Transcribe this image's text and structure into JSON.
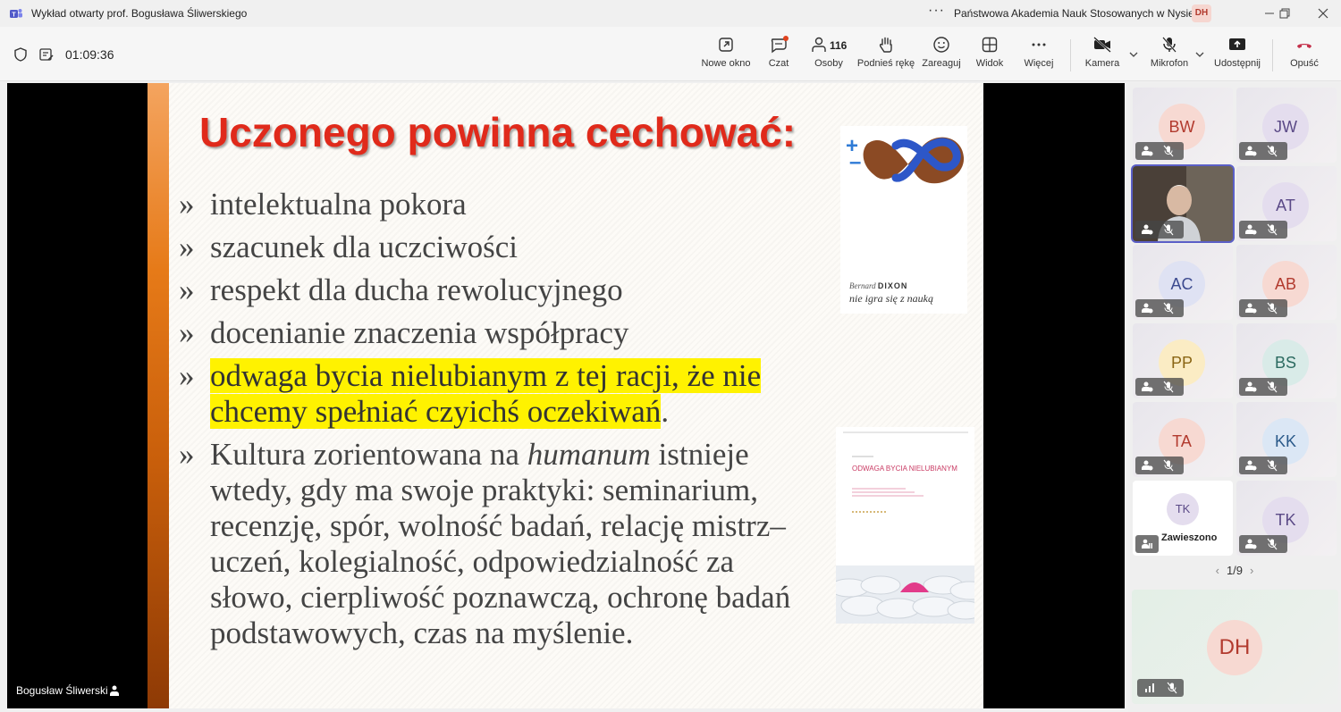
{
  "window": {
    "title": "Wykład otwarty prof. Bogusława Śliwerskiego",
    "more": "···",
    "org": "Państwowa Akademia Nauk Stosowanych w Nysie",
    "org_initials": "DH"
  },
  "toolbar": {
    "timer": "01:09:36",
    "buttons": {
      "new_window": "Nowe okno",
      "chat": "Czat",
      "people": "Osoby",
      "people_count": "116",
      "raise_hand": "Podnieś rękę",
      "react": "Zareaguj",
      "view": "Widok",
      "more": "Więcej",
      "camera": "Kamera",
      "mic": "Mikrofon",
      "share": "Udostępnij",
      "leave": "Opuść"
    },
    "leave_color": "#c4314b"
  },
  "stage": {
    "speaker_name": "Bogusław Śliwerski",
    "slide": {
      "title": "Uczonego powinna cechować:",
      "bullet_mark": "»",
      "bullets": [
        "intelektualna pokora",
        "szacunek dla uczciwości",
        "respekt dla ducha rewolucyjnego",
        "docenianie znaczenia współpracy"
      ],
      "highlight_line1": "odwaga bycia nielubianym z tej racji, że nie",
      "highlight_line2": "chcemy spełniać czyichś oczekiwań",
      "highlight_end": ".",
      "last_pre": "Kultura zorientowana na ",
      "last_italic": "humanum",
      "last_post": " istnieje wtedy, gdy ma swoje praktyki: seminarium, recenzję, spór, wolność badań, relację mistrz–uczeń, kolegialność, odpowiedzialność za słowo, cierpliwość poznawczą, ochronę badań podstawowych, czas na myślenie.",
      "book1_author_first": "Bernard",
      "book1_author_last": "DIXON",
      "book1_title": "nie igra się z nauką",
      "book2_title": "ODWAGA BYCIA NIELUBIANYM"
    }
  },
  "participants": [
    {
      "initials": "BW",
      "bg": "#f7d9d2",
      "fg": "#b23a2e"
    },
    {
      "initials": "JW",
      "bg": "#e4ddee",
      "fg": "#5b4a87"
    },
    {
      "initials": "",
      "bg": "#333333",
      "fg": "#ffffff"
    },
    {
      "initials": "AT",
      "bg": "#e4ddee",
      "fg": "#5b4a87"
    },
    {
      "initials": "AC",
      "bg": "#dfe2f3",
      "fg": "#3c4a8f"
    },
    {
      "initials": "AB",
      "bg": "#f7d9d2",
      "fg": "#b23a2e"
    },
    {
      "initials": "PP",
      "bg": "#fbecc4",
      "fg": "#8a6514"
    },
    {
      "initials": "BS",
      "bg": "#d9ebe8",
      "fg": "#2b6a60"
    },
    {
      "initials": "TA",
      "bg": "#f7d9d2",
      "fg": "#b23a2e"
    },
    {
      "initials": "KK",
      "bg": "#dbe7f5",
      "fg": "#2b5a8a"
    },
    {
      "initials": "TK",
      "bg": "#e4ddee",
      "fg": "#5b4a87"
    },
    {
      "initials": "TK",
      "bg": "#e4ddee",
      "fg": "#5b4a87"
    }
  ],
  "on_hold_label": "Zawieszono",
  "pager": {
    "text": "1/9",
    "prev": "‹",
    "next": "›"
  },
  "self": {
    "initials": "DH"
  }
}
